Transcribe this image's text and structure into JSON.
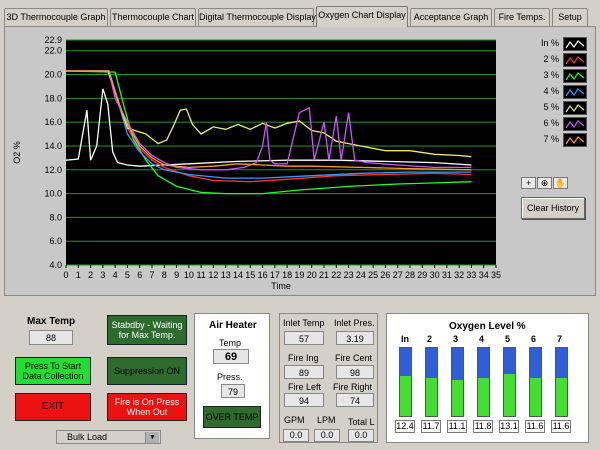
{
  "tabs": [
    "3D Thermocouple Graph",
    "Thermocouple Chart",
    "Digital Thermocouple Display",
    "Oxygen Chart Display",
    "Acceptance Graph",
    "Fire Temps.",
    "Setup"
  ],
  "active_tab": "Oxygen Chart Display",
  "chart_data": {
    "type": "line",
    "title": "",
    "xlabel": "Time",
    "ylabel": "O2 %",
    "xlim": [
      0,
      35
    ],
    "ylim": [
      4.0,
      22.9
    ],
    "x_ticks": [
      "0",
      "1",
      "2",
      "3",
      "4",
      "5",
      "6",
      "7",
      "8",
      "9",
      "10",
      "11",
      "12",
      "13",
      "14",
      "15",
      "16",
      "17",
      "18",
      "19",
      "20",
      "21",
      "22",
      "23",
      "24",
      "25",
      "26",
      "27",
      "28",
      "29",
      "30",
      "31",
      "32",
      "33",
      "34",
      "35"
    ],
    "y_ticks": [
      "4.0",
      "6.0",
      "8.0",
      "10.0",
      "12.0",
      "14.0",
      "16.0",
      "18.0",
      "20.0",
      "22.0",
      "22.9"
    ],
    "grid": true,
    "background": "#000000",
    "legend_position": "right",
    "series": [
      {
        "name": "In %",
        "color": "#ffffff",
        "points": [
          [
            0,
            12.8
          ],
          [
            1,
            12.9
          ],
          [
            1.7,
            17
          ],
          [
            2,
            12.8
          ],
          [
            2.5,
            14
          ],
          [
            3,
            18.8
          ],
          [
            3.4,
            17.5
          ],
          [
            3.8,
            13.5
          ],
          [
            4.2,
            12.6
          ],
          [
            5,
            12.4
          ],
          [
            6,
            12.3
          ],
          [
            8,
            12.4
          ],
          [
            10,
            12.5
          ],
          [
            14,
            12.7
          ],
          [
            18,
            12.8
          ],
          [
            22,
            12.8
          ],
          [
            26,
            12.7
          ],
          [
            30,
            12.6
          ],
          [
            33,
            12.4
          ]
        ]
      },
      {
        "name": "2 %",
        "color": "#ff3333",
        "points": [
          [
            0,
            20.3
          ],
          [
            3.5,
            20.3
          ],
          [
            4.2,
            18
          ],
          [
            5,
            15.5
          ],
          [
            6,
            13.8
          ],
          [
            7,
            12.8
          ],
          [
            8,
            12.2
          ],
          [
            10,
            11.5
          ],
          [
            12,
            11.1
          ],
          [
            15,
            11
          ],
          [
            18,
            11.2
          ],
          [
            22,
            11.5
          ],
          [
            26,
            11.6
          ],
          [
            30,
            11.7
          ],
          [
            33,
            11.6
          ]
        ]
      },
      {
        "name": "3 %",
        "color": "#22ff22",
        "points": [
          [
            0,
            20.3
          ],
          [
            4,
            20.2
          ],
          [
            4.8,
            17
          ],
          [
            5.5,
            14.5
          ],
          [
            6.5,
            12.8
          ],
          [
            7.5,
            11.5
          ],
          [
            9,
            10.6
          ],
          [
            11,
            10.1
          ],
          [
            13,
            10
          ],
          [
            16,
            10
          ],
          [
            19,
            10.3
          ],
          [
            23,
            10.6
          ],
          [
            27,
            10.8
          ],
          [
            30,
            10.9
          ],
          [
            33,
            11
          ]
        ]
      },
      {
        "name": "4 %",
        "color": "#3399ff",
        "points": [
          [
            0,
            20.3
          ],
          [
            3.5,
            20.3
          ],
          [
            4.3,
            17.5
          ],
          [
            5,
            15
          ],
          [
            6,
            13.5
          ],
          [
            7,
            12.5
          ],
          [
            8,
            12
          ],
          [
            10,
            11.6
          ],
          [
            13,
            11.3
          ],
          [
            16,
            11.3
          ],
          [
            20,
            11.5
          ],
          [
            24,
            11.7
          ],
          [
            28,
            11.8
          ],
          [
            33,
            11.8
          ]
        ]
      },
      {
        "name": "5 %",
        "color": "#eeee66",
        "points": [
          [
            0,
            20.3
          ],
          [
            3.4,
            20.3
          ],
          [
            4,
            18.5
          ],
          [
            5,
            15.5
          ],
          [
            6.5,
            15
          ],
          [
            7.5,
            14.2
          ],
          [
            8.2,
            14.5
          ],
          [
            8.8,
            15.8
          ],
          [
            9.3,
            17
          ],
          [
            9.8,
            17.1
          ],
          [
            10.3,
            15.8
          ],
          [
            11,
            15
          ],
          [
            12,
            15.6
          ],
          [
            13,
            15.4
          ],
          [
            14,
            15.8
          ],
          [
            15,
            15.4
          ],
          [
            16,
            15.9
          ],
          [
            17,
            15.5
          ],
          [
            18,
            15.9
          ],
          [
            19,
            16.1
          ],
          [
            20,
            15.3
          ],
          [
            21,
            15.1
          ],
          [
            22,
            14.4
          ],
          [
            23,
            14.2
          ],
          [
            24,
            14
          ],
          [
            26,
            13.6
          ],
          [
            28,
            13.6
          ],
          [
            30,
            13.3
          ],
          [
            32,
            13.2
          ],
          [
            33,
            13.1
          ]
        ]
      },
      {
        "name": "6 %",
        "color": "#cc55ff",
        "points": [
          [
            0,
            20.3
          ],
          [
            3.5,
            20.3
          ],
          [
            4,
            18
          ],
          [
            5,
            16
          ],
          [
            6,
            14.2
          ],
          [
            7,
            13.2
          ],
          [
            8,
            12.6
          ],
          [
            9,
            12.2
          ],
          [
            11,
            12
          ],
          [
            13,
            12
          ],
          [
            14.5,
            12.2
          ],
          [
            15.5,
            12.6
          ],
          [
            16,
            14
          ],
          [
            16.3,
            16
          ],
          [
            16.6,
            12.8
          ],
          [
            17,
            12.5
          ],
          [
            18,
            12.5
          ],
          [
            19,
            16.8
          ],
          [
            19.8,
            17.2
          ],
          [
            20.2,
            12.8
          ],
          [
            21,
            16
          ],
          [
            21.4,
            12.8
          ],
          [
            22,
            16.5
          ],
          [
            22.4,
            12.8
          ],
          [
            23,
            16.8
          ],
          [
            23.5,
            12.8
          ],
          [
            24.5,
            12.6
          ],
          [
            27,
            12.4
          ],
          [
            30,
            12.2
          ],
          [
            33,
            12.2
          ]
        ]
      },
      {
        "name": "7 %",
        "color": "#ff9933",
        "points": [
          [
            0,
            20.3
          ],
          [
            3.5,
            20.3
          ],
          [
            4.2,
            17.8
          ],
          [
            5,
            15.8
          ],
          [
            6,
            14
          ],
          [
            7,
            13
          ],
          [
            8,
            12.4
          ],
          [
            10,
            12.2
          ],
          [
            12,
            12.3
          ],
          [
            14,
            12.5
          ],
          [
            16,
            12.4
          ],
          [
            18,
            12.3
          ],
          [
            20,
            12.3
          ],
          [
            24,
            12.2
          ],
          [
            28,
            12.1
          ],
          [
            33,
            12
          ]
        ]
      }
    ]
  },
  "legend": {
    "items": [
      "In %",
      "2 %",
      "3 %",
      "4 %",
      "5 %",
      "6 %",
      "7 %"
    ]
  },
  "tools": {
    "cursor": "+",
    "zoom": "⊕",
    "pan": "✋"
  },
  "clear_history_label": "Clear History",
  "max_temp": {
    "label": "Max Temp",
    "value": "88"
  },
  "buttons": {
    "start": "Press To Start Data Collection",
    "exit": "EXIT",
    "standby": "Stabdby - Waiting for Max Temp.",
    "suppression": "Suppression ON",
    "fire": "Fire is On Press When Out",
    "over_temp": "OVER TEMP"
  },
  "dropdown": {
    "value": "Bulk Load"
  },
  "air_heater": {
    "title": "Air Heater",
    "temp_label": "Temp",
    "temp_value": "69",
    "press_label": "Press.",
    "press_value": "79"
  },
  "inlet": {
    "temp_label": "Inlet Temp",
    "temp_value": "57",
    "pres_label": "Inlet Pres.",
    "pres_value": "3.19",
    "fire_ing_label": "Fire Ing",
    "fire_ing_value": "89",
    "fire_cent_label": "Fire Cent",
    "fire_cent_value": "98",
    "fire_left_label": "Fire Left",
    "fire_left_value": "94",
    "fire_right_label": "Fire Right",
    "fire_right_value": "74",
    "gpm_label": "GPM",
    "gpm_value": "0.0",
    "lpm_label": "LPM",
    "lpm_value": "0.0",
    "total_label": "Total L",
    "total_value": "0.0"
  },
  "oxygen_level": {
    "title": "Oxygen Level %",
    "columns": [
      {
        "label": "In",
        "value": "12.4",
        "level": 12.4
      },
      {
        "label": "2",
        "value": "11.7",
        "level": 11.7
      },
      {
        "label": "3",
        "value": "11.1",
        "level": 11.1
      },
      {
        "label": "4",
        "value": "11.8",
        "level": 11.8
      },
      {
        "label": "5",
        "value": "13.1",
        "level": 13.1
      },
      {
        "label": "6",
        "value": "11.6",
        "level": 11.6
      },
      {
        "label": "7",
        "value": "11.6",
        "level": 11.6
      }
    ],
    "scale_max": 21
  }
}
